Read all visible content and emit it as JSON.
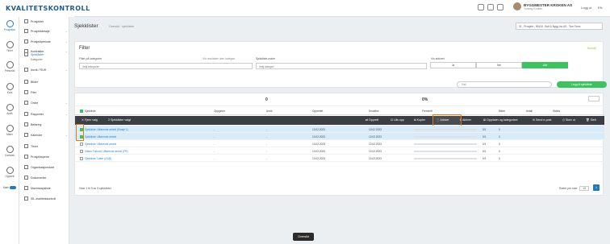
{
  "app": {
    "logo_text": "KVALITETSKONTROLL",
    "brand_color": "#1f5a8c",
    "accent_color": "#3cc25e"
  },
  "header": {
    "user_name": "BYGGMESTER KROKEN AS",
    "user_sub": "Tommy Kroken",
    "logout": "Logg ut",
    "lang": "EN"
  },
  "rail": [
    {
      "label": "Prosjekter",
      "icon": "folder-icon"
    },
    {
      "label": "Timer",
      "icon": "clock-icon"
    },
    {
      "label": "Personal",
      "icon": "people-icon"
    },
    {
      "label": "Kurs",
      "icon": "graduation-icon"
    },
    {
      "label": "Avvik",
      "icon": "warning-icon"
    },
    {
      "label": "Maler",
      "icon": "template-icon"
    },
    {
      "label": "Kartotek",
      "icon": "archive-icon"
    },
    {
      "label": "Oppsett",
      "icon": "gear-icon"
    }
  ],
  "rail_toggle_label": "Mørk",
  "sidebar": {
    "items": [
      {
        "label": "Prosjekter"
      },
      {
        "label": "Prosjektdetalje",
        "chev": "⌄"
      },
      {
        "label": "Prosjektperiode",
        "chev": "⌄"
      },
      {
        "label": "Kontrakter",
        "chev": "⌄"
      },
      {
        "label": "Sjekklister"
      },
      {
        "label": "Avvik / RUH",
        "chev": "⌄"
      },
      {
        "label": "Bilder"
      },
      {
        "label": "Filer"
      },
      {
        "label": "Ordre",
        "chev": "⌄"
      },
      {
        "label": "Rapporter",
        "chev": "⌄"
      },
      {
        "label": "Befaring"
      },
      {
        "label": "Kalender",
        "chev": "⌄"
      },
      {
        "label": "Timer"
      },
      {
        "label": "Prosjektsperre"
      },
      {
        "label": "Organisasjonskart"
      },
      {
        "label": "Dokumenter"
      },
      {
        "label": "Mannskapsliste"
      },
      {
        "label": "SIL-kvalitetskontroll"
      }
    ],
    "sub_label": "Kategorier"
  },
  "page": {
    "title": "Sjekklister",
    "crumb": "Oversikt · sjekklister",
    "project_select": "31 - Prosjekt - 90418 - Bolt & Bygg Inc AS - Tom Toms"
  },
  "filter": {
    "title": "Filter",
    "reset": "Nullstill",
    "category_label": "Filter på kategorier",
    "category_placeholder": "Velg kategorier",
    "show_all_label": "Vis resultater uten kategori",
    "template_label": "Sjekkliste-maler",
    "template_placeholder": "Velg kategori",
    "archived_label": "Vis arkivert",
    "segments": [
      "Ja",
      "Nei",
      "Alle"
    ],
    "active_segment": "Alle"
  },
  "search": {
    "placeholder": "Søk"
  },
  "new_button": "Legg til sjekkliste",
  "stats": {
    "count": "0",
    "percent": "0%"
  },
  "table": {
    "headers": [
      "Sjekkliste",
      "Oppgaver",
      "Avvik",
      "Opprettet",
      "Deadline",
      "Fremdrift",
      "Bilder",
      "Antall",
      "Status"
    ],
    "action_bar": {
      "deselect": "Fjern valg",
      "selected_count": "2 Sjekklister valgt",
      "buttons": [
        "Opprett",
        "Lås opp",
        "Kopier",
        "Arkiver",
        "Aktiver",
        "Oppdater og kategoriser",
        "Send e-post",
        "Skriv ut",
        "Slett"
      ]
    },
    "rows": [
      {
        "name": "Sjekkliste: Utførende arbeid (Etasje 1)",
        "tasks": "-",
        "dev": "-",
        "created": "13.02.2023",
        "deadline": "13.02.2023",
        "pct": "0/1",
        "photos": "0",
        "selected": true
      },
      {
        "name": "Sjekkliste: Utførende arbeid",
        "tasks": "-",
        "dev": "-",
        "created": "13.02.2023",
        "deadline": "13.02.2023",
        "pct": "0/1",
        "photos": "0",
        "selected": true
      },
      {
        "name": "Sjekkliste: Utførende arbeid",
        "tasks": "-",
        "dev": "-",
        "created": "13.02.2023",
        "deadline": "13.02.2023",
        "pct": "0/1",
        "photos": "0",
        "selected": false
      },
      {
        "name": "Sikker Forhold: Utførende arbeid (FR)",
        "tasks": "-",
        "dev": "-",
        "created": "13.02.2023",
        "deadline": "13.02.2023",
        "pct": "0/1",
        "photos": "0",
        "selected": false
      },
      {
        "name": "Sjekkliste: Løker (A1/B)",
        "tasks": "-",
        "dev": "-",
        "created": "13.02.2023",
        "deadline": "13.02.2023",
        "pct": "0/1",
        "photos": "0",
        "selected": false
      }
    ],
    "footer": "Viser 1 til 5 av 5 sjekklister",
    "per_page_label": "Rader per side:",
    "per_page": "10",
    "page": "1"
  },
  "tooltip": "Oversikt"
}
